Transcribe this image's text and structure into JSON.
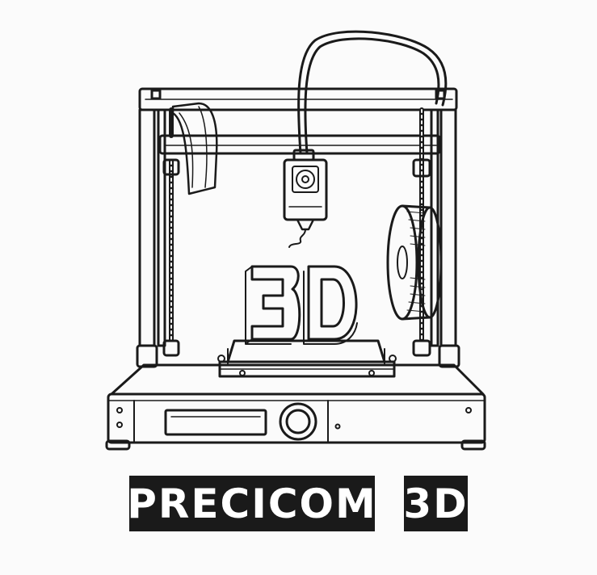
{
  "logo": {
    "name": "PRECICOM",
    "suffix": "3D",
    "illustration": "3d-printer-drawing",
    "printed_object_text": "3D",
    "colors": {
      "background": "#fbfbfb",
      "ink": "#1a1a1a",
      "label_text": "#ffffff"
    }
  }
}
